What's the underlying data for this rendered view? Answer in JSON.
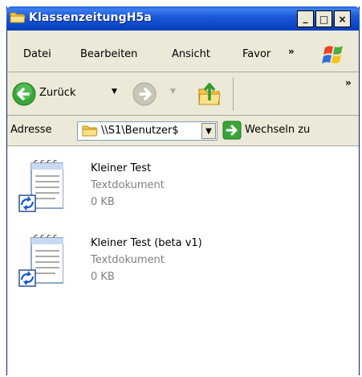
{
  "window": {
    "title": "KlassenzeitungH5a",
    "controls": [
      "_",
      "□",
      "×"
    ]
  },
  "menu": {
    "items": [
      "Datei",
      "Bearbeiten",
      "Ansicht",
      "Favor"
    ],
    "overflow": "»"
  },
  "toolbar": {
    "back_label": "Zurück",
    "overflow": "»"
  },
  "address": {
    "label": "Adresse",
    "value": "\\\\S1\\Benutzer$",
    "go_label": "Wechseln zu"
  },
  "files": [
    {
      "name": "Kleiner Test",
      "type": "Textdokument",
      "size": "0 KB"
    },
    {
      "name": "Kleiner Test (beta v1)",
      "type": "Textdokument",
      "size": "0 KB"
    }
  ],
  "colors": {
    "titlebar": "#0a46c8",
    "chrome": "#ece9d8",
    "back_arrow": "#3aa43a",
    "secondary_text": "#808080"
  },
  "icons": [
    "folder-icon",
    "back-arrow-icon",
    "forward-arrow-icon",
    "up-folder-icon",
    "go-arrow-icon",
    "text-document-icon",
    "sync-icon",
    "windows-logo-icon"
  ]
}
